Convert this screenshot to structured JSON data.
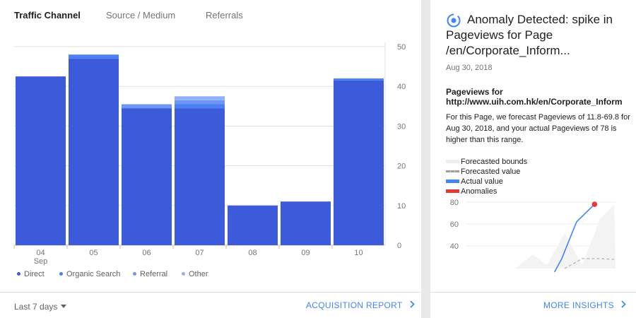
{
  "tabs": [
    {
      "label": "Traffic Channel",
      "active": true
    },
    {
      "label": "Source / Medium",
      "active": false
    },
    {
      "label": "Referrals",
      "active": false
    }
  ],
  "chart_data": {
    "type": "bar",
    "stacked": true,
    "categories": [
      "04",
      "05",
      "06",
      "07",
      "08",
      "09",
      "10"
    ],
    "category_sublabels": [
      "Sep",
      "",
      "",
      "",
      "",
      "",
      ""
    ],
    "series": [
      {
        "name": "Direct",
        "color": "#3b5bdb",
        "values": [
          42.5,
          47,
          34.5,
          34.5,
          10,
          11,
          41.5
        ]
      },
      {
        "name": "Organic Search",
        "color": "#4a7ff5",
        "values": [
          0,
          1,
          0,
          1,
          0,
          0,
          0.5
        ]
      },
      {
        "name": "Referral",
        "color": "#6e96f5",
        "values": [
          0,
          0,
          1,
          1,
          0,
          0,
          0
        ]
      },
      {
        "name": "Other",
        "color": "#90b0f9",
        "values": [
          0,
          0,
          0,
          1,
          0,
          0,
          0
        ]
      }
    ],
    "y_ticks": [
      0,
      10,
      20,
      30,
      40,
      50
    ],
    "ylim": [
      0,
      50
    ],
    "y_axis_side": "right",
    "grid": true,
    "legend_position": "bottom-left"
  },
  "footer": {
    "date_range": "Last 7 days",
    "report_link": "ACQUISITION REPORT"
  },
  "insight": {
    "title": "Anomaly Detected: spike in Pageviews for Page /en/Corporate_Inform...",
    "date": "Aug 30, 2018",
    "metric_title_line1": "Pageviews for",
    "metric_title_line2": "http://www.uih.com.hk/en/Corporate_Inform",
    "description": "For this Page, we forecast Pageviews of 11.8-69.8 for Aug 30, 2018, and your actual Pageviews of 78 is higher than this range.",
    "legend": [
      {
        "label": "Forecasted bounds",
        "color": "#eeeeee",
        "style": "solid"
      },
      {
        "label": "Forecasted value",
        "color": "#9e9e9e",
        "style": "dashed"
      },
      {
        "label": "Actual value",
        "color": "#4285f4",
        "style": "solid"
      },
      {
        "label": "Anomalies",
        "color": "#e53935",
        "style": "solid"
      }
    ],
    "mini_chart": {
      "y_ticks": [
        80,
        60,
        40
      ],
      "actual_points": [
        [
          0.64,
          28
        ],
        [
          0.74,
          62
        ],
        [
          0.86,
          78
        ]
      ],
      "anomaly_value": 78,
      "anomaly_color": "#e53935",
      "actual_color": "#4285f4"
    },
    "more_link": "MORE INSIGHTS"
  }
}
